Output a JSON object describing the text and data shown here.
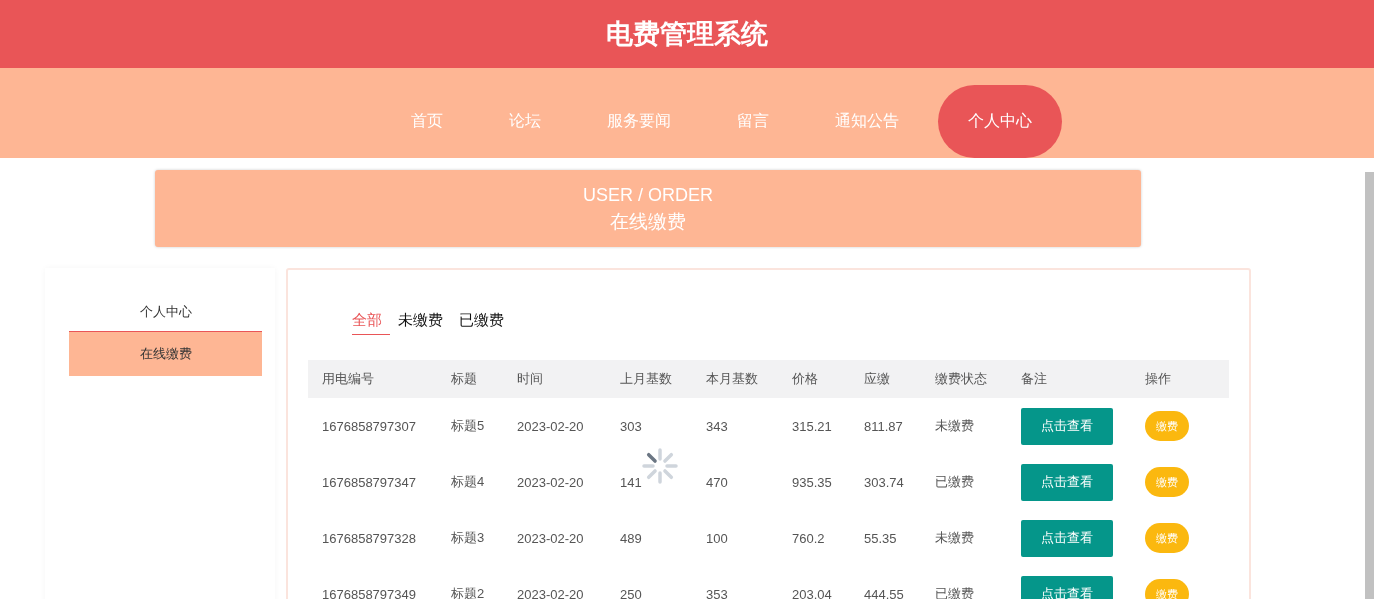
{
  "header": {
    "title": "电费管理系统"
  },
  "nav": [
    {
      "label": "首页",
      "selected": false
    },
    {
      "label": "论坛",
      "selected": false
    },
    {
      "label": "服务要闻",
      "selected": false
    },
    {
      "label": "留言",
      "selected": false
    },
    {
      "label": "通知公告",
      "selected": false
    },
    {
      "label": "个人中心",
      "selected": true
    }
  ],
  "banner": {
    "subtitle": "USER / ORDER",
    "title": "在线缴费"
  },
  "sidebar": {
    "items": [
      {
        "label": "个人中心",
        "selected": false
      },
      {
        "label": "在线缴费",
        "selected": true
      }
    ]
  },
  "filter_tabs": [
    {
      "label": "全部",
      "selected": true
    },
    {
      "label": "未缴费",
      "selected": false
    },
    {
      "label": "已缴费",
      "selected": false
    }
  ],
  "table": {
    "columns": [
      "用电编号",
      "标题",
      "时间",
      "上月基数",
      "本月基数",
      "价格",
      "应缴",
      "缴费状态",
      "备注",
      "操作"
    ],
    "rows": [
      {
        "cells": [
          "1676858797307",
          "标题5",
          "2023-02-20",
          "303",
          "343",
          "315.21",
          "811.87",
          "未缴费"
        ],
        "view": "点击查看",
        "pay": "缴费"
      },
      {
        "cells": [
          "1676858797347",
          "标题4",
          "2023-02-20",
          "141",
          "470",
          "935.35",
          "303.74",
          "已缴费"
        ],
        "view": "点击查看",
        "pay": "缴费"
      },
      {
        "cells": [
          "1676858797328",
          "标题3",
          "2023-02-20",
          "489",
          "100",
          "760.2",
          "55.35",
          "未缴费"
        ],
        "view": "点击查看",
        "pay": "缴费"
      },
      {
        "cells": [
          "1676858797349",
          "标题2",
          "2023-02-20",
          "250",
          "353",
          "203.04",
          "444.55",
          "已缴费"
        ],
        "view": "点击查看",
        "pay": "缴费"
      }
    ]
  }
}
